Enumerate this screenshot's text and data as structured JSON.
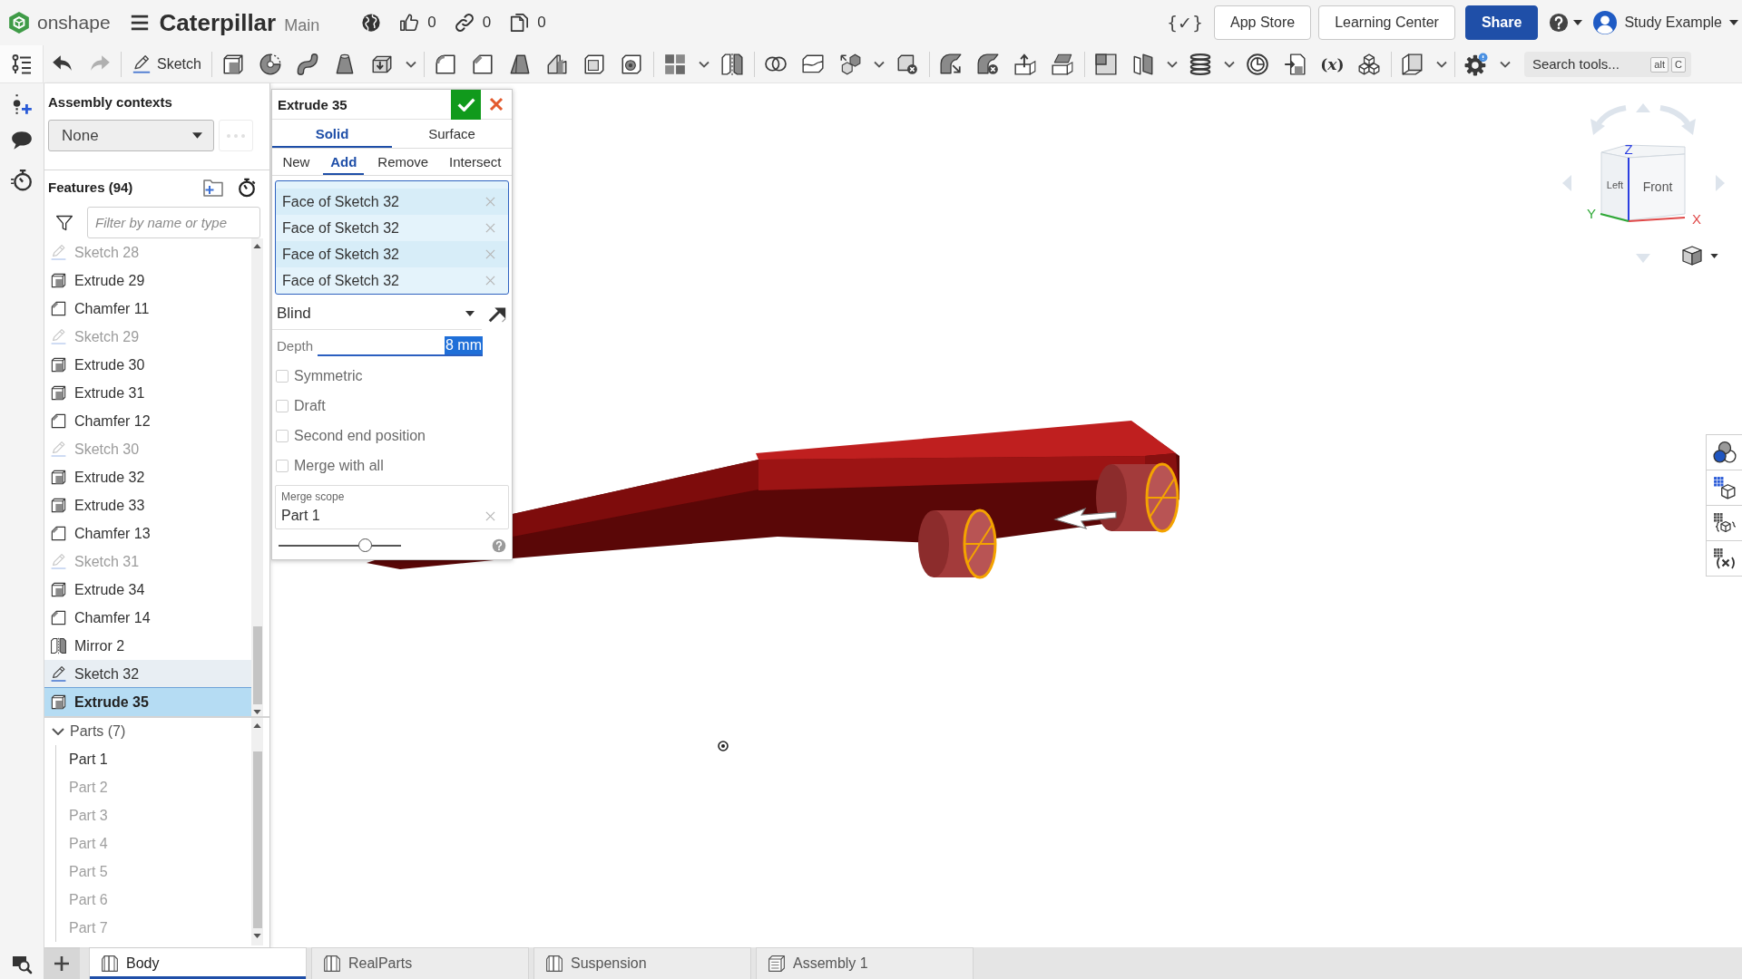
{
  "header": {
    "logo_text": "onshape",
    "document_title": "Caterpillar",
    "workspace": "Main",
    "counters": [
      {
        "kind": "likes",
        "count": "0"
      },
      {
        "kind": "links",
        "count": "0"
      },
      {
        "kind": "copies",
        "count": "0"
      }
    ],
    "variables_glyph": "{✓}",
    "buttons": [
      {
        "label": "App Store",
        "kind": "outline"
      },
      {
        "label": "Learning Center",
        "kind": "outline"
      },
      {
        "label": "Share",
        "kind": "primary"
      }
    ],
    "user": {
      "name": "Study Example"
    }
  },
  "toolbar": {
    "sketch_label": "Sketch",
    "variable_glyph": "(*x*)",
    "search": {
      "placeholder": "Search tools...",
      "keys": [
        "alt",
        "C"
      ]
    }
  },
  "assembly_contexts": {
    "title": "Assembly contexts",
    "dropdown": {
      "value": "None"
    },
    "more_button": {
      "disabled": true
    }
  },
  "features": {
    "title": "Features (94)",
    "filter": {
      "placeholder": "Filter by name or type"
    },
    "items": [
      {
        "label": "Sketch 28",
        "kind": "sketch",
        "hidden": true,
        "highlighted": false,
        "selected": false
      },
      {
        "label": "Extrude 29",
        "kind": "extrude",
        "hidden": false,
        "highlighted": false,
        "selected": false
      },
      {
        "label": "Chamfer 11",
        "kind": "chamfer",
        "hidden": false,
        "highlighted": false,
        "selected": false
      },
      {
        "label": "Sketch 29",
        "kind": "sketch",
        "hidden": true,
        "highlighted": false,
        "selected": false
      },
      {
        "label": "Extrude 30",
        "kind": "extrude",
        "hidden": false,
        "highlighted": false,
        "selected": false
      },
      {
        "label": "Extrude 31",
        "kind": "extrude",
        "hidden": false,
        "highlighted": false,
        "selected": false
      },
      {
        "label": "Chamfer 12",
        "kind": "chamfer",
        "hidden": false,
        "highlighted": false,
        "selected": false
      },
      {
        "label": "Sketch 30",
        "kind": "sketch",
        "hidden": true,
        "highlighted": false,
        "selected": false
      },
      {
        "label": "Extrude 32",
        "kind": "extrude",
        "hidden": false,
        "highlighted": false,
        "selected": false
      },
      {
        "label": "Extrude 33",
        "kind": "extrude",
        "hidden": false,
        "highlighted": false,
        "selected": false
      },
      {
        "label": "Chamfer 13",
        "kind": "chamfer",
        "hidden": false,
        "highlighted": false,
        "selected": false
      },
      {
        "label": "Sketch 31",
        "kind": "sketch",
        "hidden": true,
        "highlighted": false,
        "selected": false
      },
      {
        "label": "Extrude 34",
        "kind": "extrude",
        "hidden": false,
        "highlighted": false,
        "selected": false
      },
      {
        "label": "Chamfer 14",
        "kind": "chamfer",
        "hidden": false,
        "highlighted": false,
        "selected": false
      },
      {
        "label": "Mirror 2",
        "kind": "mirror",
        "hidden": false,
        "highlighted": false,
        "selected": false
      },
      {
        "label": "Sketch 32",
        "kind": "sketch",
        "hidden": false,
        "highlighted": true,
        "selected": false
      },
      {
        "label": "Extrude 35",
        "kind": "extrude",
        "hidden": false,
        "highlighted": false,
        "selected": true
      }
    ]
  },
  "parts": {
    "title": "Parts (7)",
    "expanded": true,
    "items": [
      {
        "label": "Part 1",
        "hidden": false
      },
      {
        "label": "Part 2",
        "hidden": true
      },
      {
        "label": "Part 3",
        "hidden": true
      },
      {
        "label": "Part 4",
        "hidden": true
      },
      {
        "label": "Part 5",
        "hidden": true
      },
      {
        "label": "Part 6",
        "hidden": true
      },
      {
        "label": "Part 7",
        "hidden": true
      }
    ]
  },
  "feature_dialog": {
    "title": "Extrude 35",
    "body_tabs": [
      {
        "label": "Solid",
        "selected": true
      },
      {
        "label": "Surface",
        "selected": false
      }
    ],
    "operation_tabs": [
      {
        "label": "New",
        "selected": false
      },
      {
        "label": "Add",
        "selected": true
      },
      {
        "label": "Remove",
        "selected": false
      },
      {
        "label": "Intersect",
        "selected": false
      }
    ],
    "selections": [
      "Face of Sketch 32",
      "Face of Sketch 32",
      "Face of Sketch 32",
      "Face of Sketch 32"
    ],
    "end_type": {
      "value": "Blind"
    },
    "depth": {
      "label": "Depth",
      "value": "8 mm"
    },
    "options": [
      {
        "label": "Symmetric",
        "checked": false
      },
      {
        "label": "Draft",
        "checked": false
      },
      {
        "label": "Second end position",
        "checked": false
      },
      {
        "label": "Merge with all",
        "checked": false
      }
    ],
    "merge_scope": {
      "label": "Merge scope",
      "value": "Part 1"
    },
    "slider": {
      "level": 0.7
    }
  },
  "view_cube": {
    "faces": [
      "Left",
      "Front"
    ],
    "axes": [
      {
        "label": "Z",
        "color": "#2b3fe0"
      },
      {
        "label": "Y",
        "color": "#2ea836"
      },
      {
        "label": "X",
        "color": "#e04848"
      }
    ]
  },
  "tabs": [
    {
      "label": "Body",
      "kind": "part_studio",
      "selected": true
    },
    {
      "label": "RealParts",
      "kind": "part_studio",
      "selected": false
    },
    {
      "label": "Suspension",
      "kind": "part_studio",
      "selected": false
    },
    {
      "label": "Assembly 1",
      "kind": "assembly",
      "selected": false
    }
  ]
}
